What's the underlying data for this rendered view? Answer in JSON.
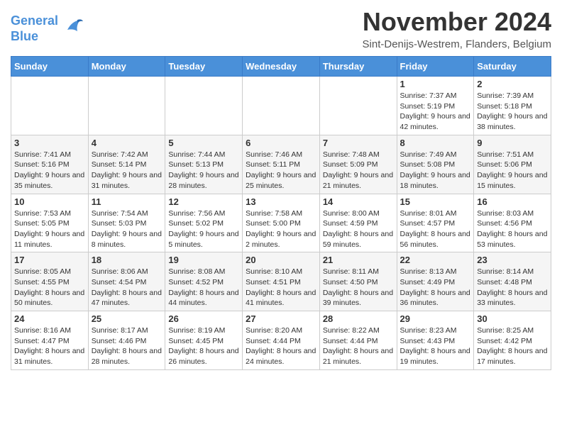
{
  "header": {
    "logo_line1": "General",
    "logo_line2": "Blue",
    "title": "November 2024",
    "location": "Sint-Denijs-Westrem, Flanders, Belgium"
  },
  "days_of_week": [
    "Sunday",
    "Monday",
    "Tuesday",
    "Wednesday",
    "Thursday",
    "Friday",
    "Saturday"
  ],
  "weeks": [
    [
      {
        "day": "",
        "info": ""
      },
      {
        "day": "",
        "info": ""
      },
      {
        "day": "",
        "info": ""
      },
      {
        "day": "",
        "info": ""
      },
      {
        "day": "",
        "info": ""
      },
      {
        "day": "1",
        "info": "Sunrise: 7:37 AM\nSunset: 5:19 PM\nDaylight: 9 hours and 42 minutes."
      },
      {
        "day": "2",
        "info": "Sunrise: 7:39 AM\nSunset: 5:18 PM\nDaylight: 9 hours and 38 minutes."
      }
    ],
    [
      {
        "day": "3",
        "info": "Sunrise: 7:41 AM\nSunset: 5:16 PM\nDaylight: 9 hours and 35 minutes."
      },
      {
        "day": "4",
        "info": "Sunrise: 7:42 AM\nSunset: 5:14 PM\nDaylight: 9 hours and 31 minutes."
      },
      {
        "day": "5",
        "info": "Sunrise: 7:44 AM\nSunset: 5:13 PM\nDaylight: 9 hours and 28 minutes."
      },
      {
        "day": "6",
        "info": "Sunrise: 7:46 AM\nSunset: 5:11 PM\nDaylight: 9 hours and 25 minutes."
      },
      {
        "day": "7",
        "info": "Sunrise: 7:48 AM\nSunset: 5:09 PM\nDaylight: 9 hours and 21 minutes."
      },
      {
        "day": "8",
        "info": "Sunrise: 7:49 AM\nSunset: 5:08 PM\nDaylight: 9 hours and 18 minutes."
      },
      {
        "day": "9",
        "info": "Sunrise: 7:51 AM\nSunset: 5:06 PM\nDaylight: 9 hours and 15 minutes."
      }
    ],
    [
      {
        "day": "10",
        "info": "Sunrise: 7:53 AM\nSunset: 5:05 PM\nDaylight: 9 hours and 11 minutes."
      },
      {
        "day": "11",
        "info": "Sunrise: 7:54 AM\nSunset: 5:03 PM\nDaylight: 9 hours and 8 minutes."
      },
      {
        "day": "12",
        "info": "Sunrise: 7:56 AM\nSunset: 5:02 PM\nDaylight: 9 hours and 5 minutes."
      },
      {
        "day": "13",
        "info": "Sunrise: 7:58 AM\nSunset: 5:00 PM\nDaylight: 9 hours and 2 minutes."
      },
      {
        "day": "14",
        "info": "Sunrise: 8:00 AM\nSunset: 4:59 PM\nDaylight: 8 hours and 59 minutes."
      },
      {
        "day": "15",
        "info": "Sunrise: 8:01 AM\nSunset: 4:57 PM\nDaylight: 8 hours and 56 minutes."
      },
      {
        "day": "16",
        "info": "Sunrise: 8:03 AM\nSunset: 4:56 PM\nDaylight: 8 hours and 53 minutes."
      }
    ],
    [
      {
        "day": "17",
        "info": "Sunrise: 8:05 AM\nSunset: 4:55 PM\nDaylight: 8 hours and 50 minutes."
      },
      {
        "day": "18",
        "info": "Sunrise: 8:06 AM\nSunset: 4:54 PM\nDaylight: 8 hours and 47 minutes."
      },
      {
        "day": "19",
        "info": "Sunrise: 8:08 AM\nSunset: 4:52 PM\nDaylight: 8 hours and 44 minutes."
      },
      {
        "day": "20",
        "info": "Sunrise: 8:10 AM\nSunset: 4:51 PM\nDaylight: 8 hours and 41 minutes."
      },
      {
        "day": "21",
        "info": "Sunrise: 8:11 AM\nSunset: 4:50 PM\nDaylight: 8 hours and 39 minutes."
      },
      {
        "day": "22",
        "info": "Sunrise: 8:13 AM\nSunset: 4:49 PM\nDaylight: 8 hours and 36 minutes."
      },
      {
        "day": "23",
        "info": "Sunrise: 8:14 AM\nSunset: 4:48 PM\nDaylight: 8 hours and 33 minutes."
      }
    ],
    [
      {
        "day": "24",
        "info": "Sunrise: 8:16 AM\nSunset: 4:47 PM\nDaylight: 8 hours and 31 minutes."
      },
      {
        "day": "25",
        "info": "Sunrise: 8:17 AM\nSunset: 4:46 PM\nDaylight: 8 hours and 28 minutes."
      },
      {
        "day": "26",
        "info": "Sunrise: 8:19 AM\nSunset: 4:45 PM\nDaylight: 8 hours and 26 minutes."
      },
      {
        "day": "27",
        "info": "Sunrise: 8:20 AM\nSunset: 4:44 PM\nDaylight: 8 hours and 24 minutes."
      },
      {
        "day": "28",
        "info": "Sunrise: 8:22 AM\nSunset: 4:44 PM\nDaylight: 8 hours and 21 minutes."
      },
      {
        "day": "29",
        "info": "Sunrise: 8:23 AM\nSunset: 4:43 PM\nDaylight: 8 hours and 19 minutes."
      },
      {
        "day": "30",
        "info": "Sunrise: 8:25 AM\nSunset: 4:42 PM\nDaylight: 8 hours and 17 minutes."
      }
    ]
  ]
}
